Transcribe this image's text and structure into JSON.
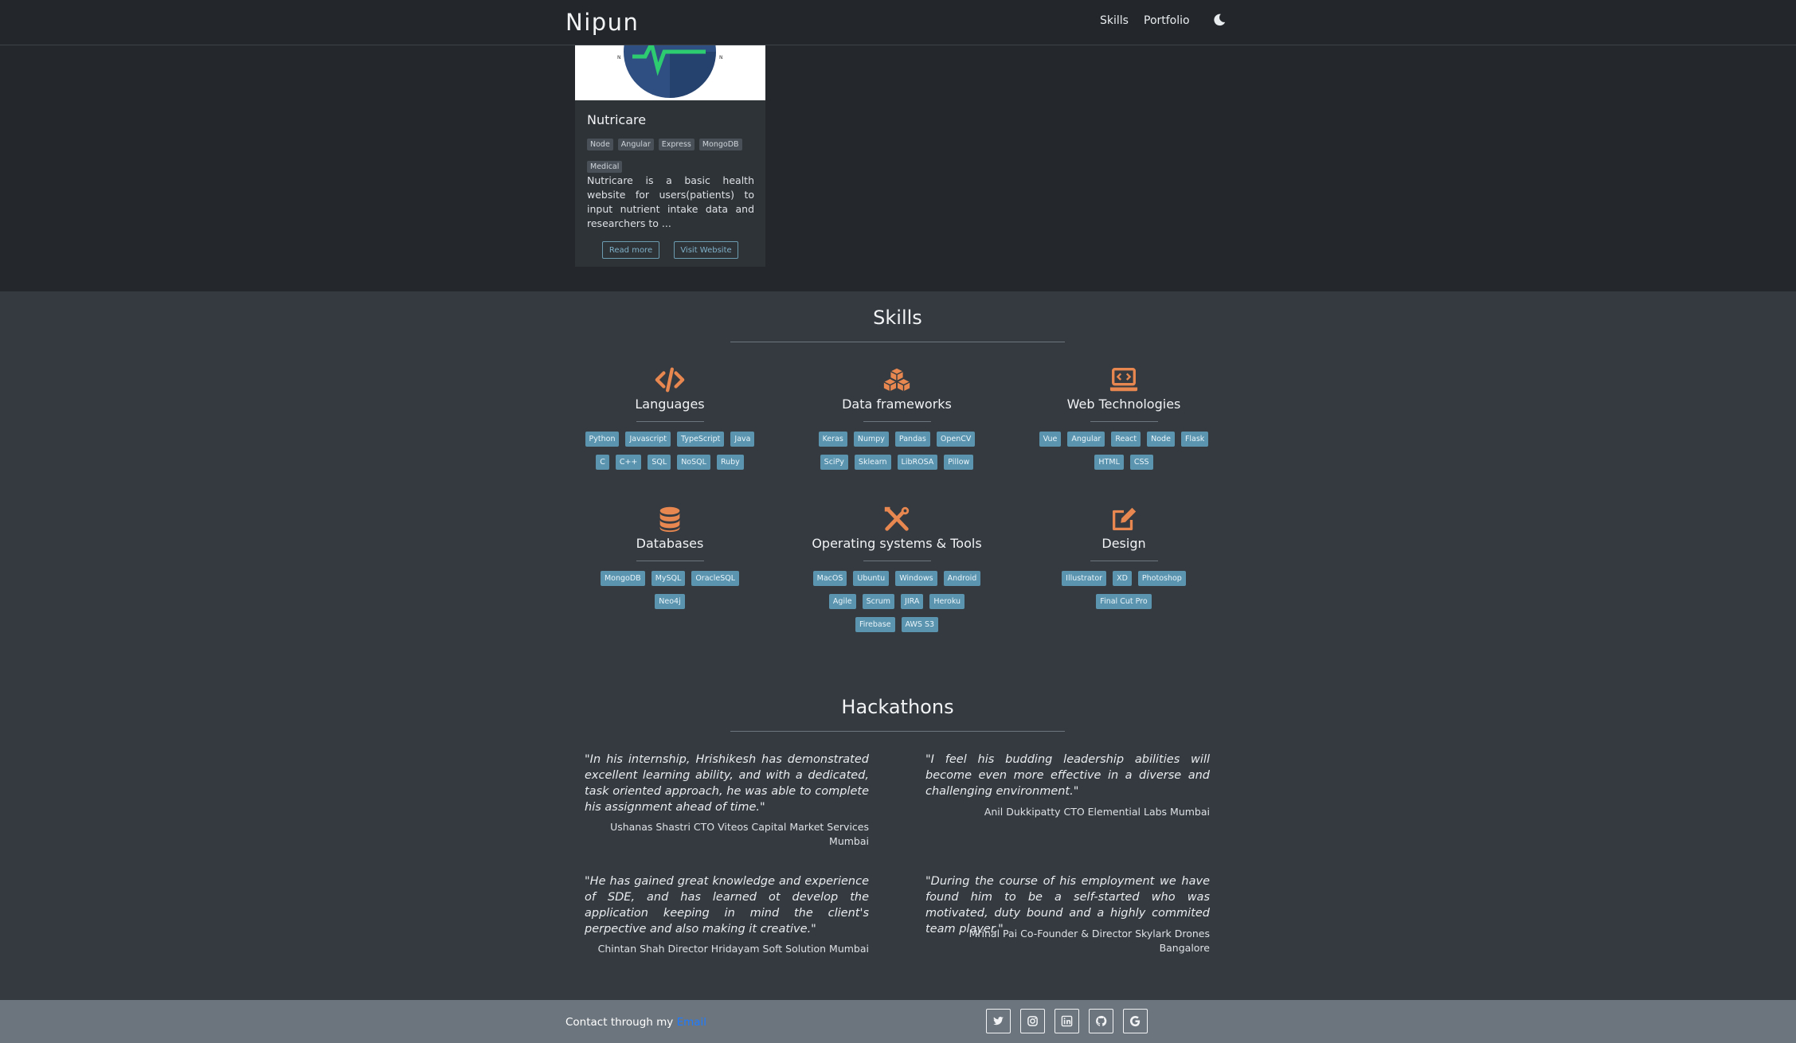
{
  "navbar": {
    "brand": "Nipun",
    "links": [
      {
        "label": "Skills"
      },
      {
        "label": "Portfolio"
      }
    ]
  },
  "portfolio_card": {
    "title": "Nutricare",
    "tags": [
      "Node",
      "Angular",
      "Express",
      "MongoDB",
      "Medical"
    ],
    "description": "Nutricare is a basic health website for users(patients) to input nutrient intake data and researchers to ...",
    "read_more": "Read more",
    "visit_website": "Visit Website"
  },
  "skills": {
    "title": "Skills",
    "categories": [
      {
        "name": "Languages",
        "icon": "code-icon",
        "items": [
          "Python",
          "Javascript",
          "TypeScript",
          "Java",
          "C",
          "C++",
          "SQL",
          "NoSQL",
          "Ruby"
        ]
      },
      {
        "name": "Data frameworks",
        "icon": "cubes-icon",
        "items": [
          "Keras",
          "Numpy",
          "Pandas",
          "OpenCV",
          "SciPy",
          "Sklearn",
          "LibROSA",
          "Pillow"
        ]
      },
      {
        "name": "Web Technologies",
        "icon": "laptop-code-icon",
        "items": [
          "Vue",
          "Angular",
          "React",
          "Node",
          "Flask",
          "HTML",
          "CSS"
        ]
      },
      {
        "name": "Databases",
        "icon": "database-icon",
        "items": [
          "MongoDB",
          "MySQL",
          "OracleSQL",
          "Neo4j"
        ]
      },
      {
        "name": "Operating systems & Tools",
        "icon": "tools-icon",
        "items": [
          "MacOS",
          "Ubuntu",
          "Windows",
          "Android",
          "Agile",
          "Scrum",
          "JIRA",
          "Heroku",
          "Firebase",
          "AWS S3"
        ]
      },
      {
        "name": "Design",
        "icon": "edit-icon",
        "items": [
          "Illustrator",
          "XD",
          "Photoshop",
          "Final Cut Pro"
        ]
      }
    ]
  },
  "hackathons": {
    "title": "Hackathons",
    "testimonials": [
      {
        "quote": "\"In his internship, Hrishikesh has demonstrated excellent learning ability, and with a dedicated, task oriented approach, he was able to complete his assignment ahead of time.\"",
        "author": "Ushanas Shastri CTO Viteos Capital Market Services Mumbai"
      },
      {
        "quote": "\"I feel his budding leadership abilities will become even more effective in a diverse and challenging environment.\"",
        "author": "Anil Dukkipatty CTO Elemential Labs Mumbai"
      },
      {
        "quote": "\"He has gained great knowledge and experience of SDE, and has learned ot develop the application keeping in mind the client's perpective and also making it creative.\"",
        "author": "Chintan Shah Director Hridayam Soft Solution Mumbai"
      },
      {
        "quote": "\"During the course of his employment we have found him to be a self-started who was motivated, duty bound and a highly commited team player.\"",
        "author": "Mrinal Pai Co-Founder & Director Skylark Drones Bangalore"
      }
    ]
  },
  "footer": {
    "contact_prefix": "Contact through my ",
    "contact_link": "Email",
    "socials": [
      "twitter-icon",
      "instagram-icon",
      "linkedin-icon",
      "github-icon",
      "google-icon"
    ]
  },
  "colors": {
    "accent_orange": "#e8874f",
    "chip_blue": "#5b94ae",
    "link_blue": "#1e7bff"
  }
}
